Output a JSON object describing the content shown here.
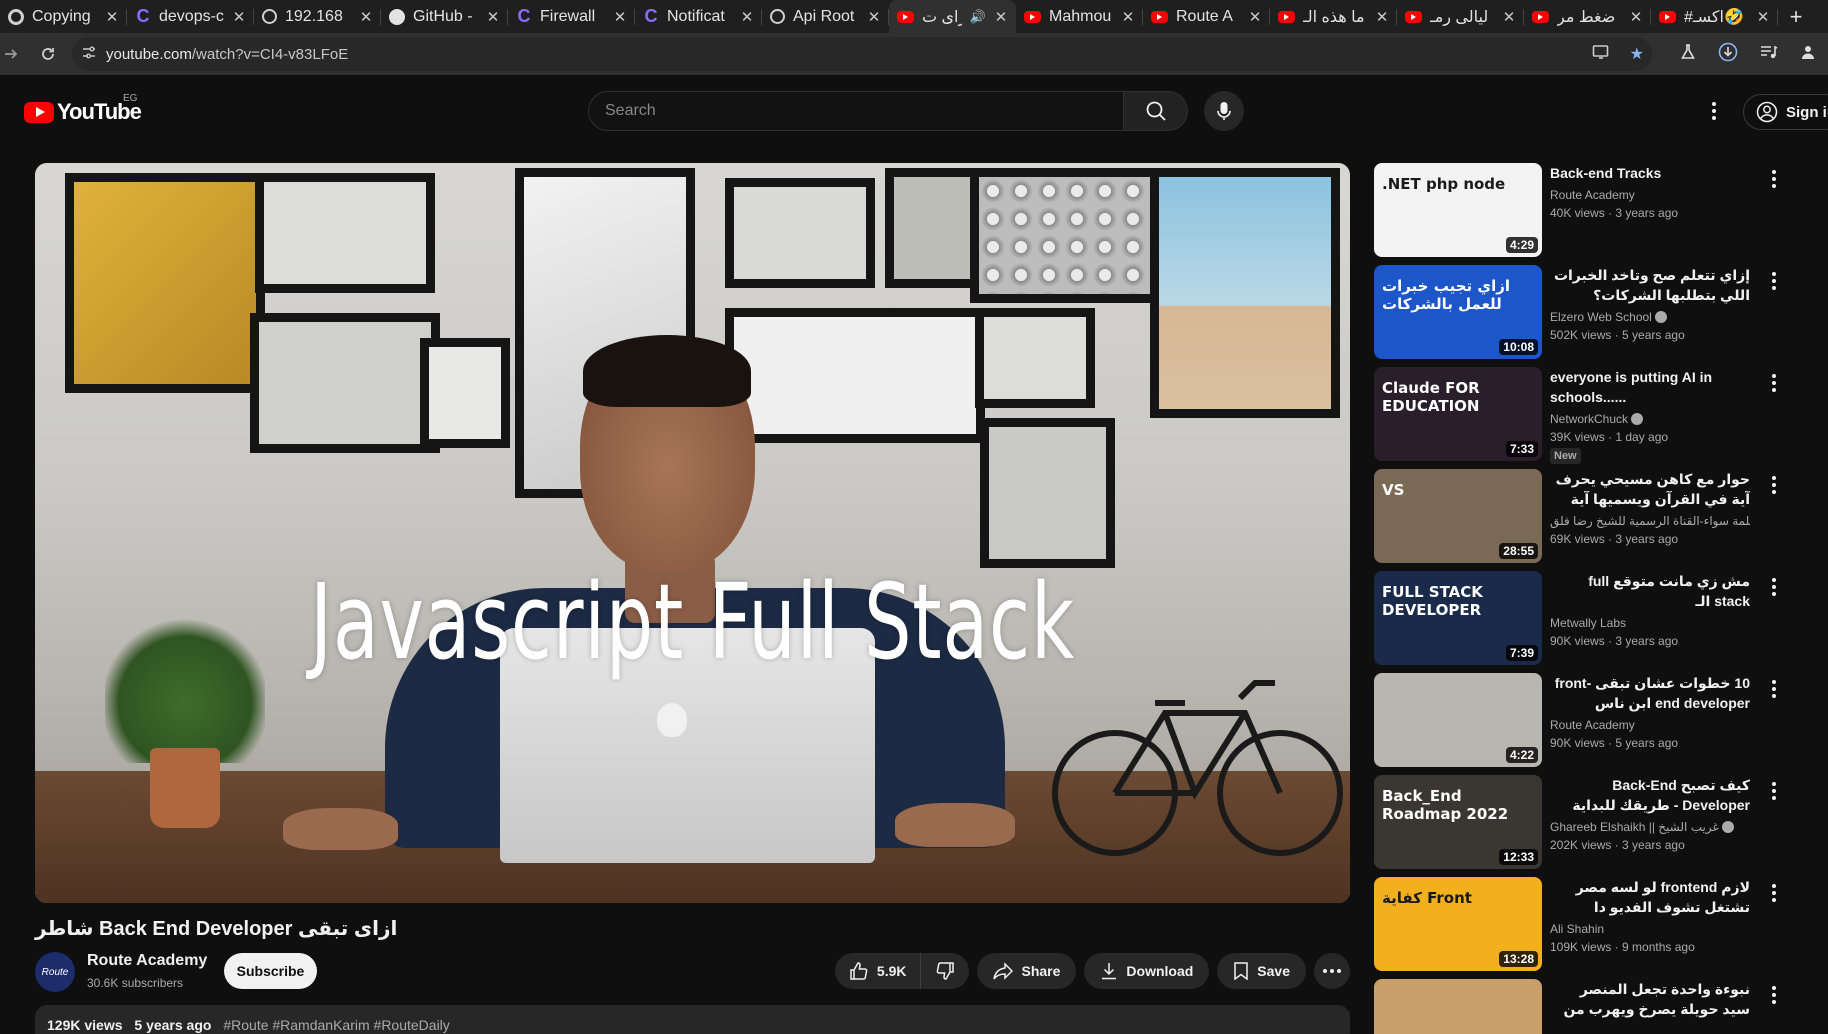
{
  "browser": {
    "tabs": [
      {
        "title": "Copying",
        "icon": "chrome-icon"
      },
      {
        "title": "devops-c",
        "icon": "c-icon"
      },
      {
        "title": "192.168",
        "icon": "globe-icon"
      },
      {
        "title": "GitHub -",
        "icon": "github-icon"
      },
      {
        "title": "Firewall",
        "icon": "c-icon"
      },
      {
        "title": "Notificat",
        "icon": "c-icon"
      },
      {
        "title": "Api Root",
        "icon": "globe-icon"
      },
      {
        "title": "ازاى ت",
        "icon": "youtube-icon",
        "active": true,
        "audio": true
      },
      {
        "title": "Mahmou",
        "icon": "youtube-icon"
      },
      {
        "title": "Route A",
        "icon": "youtube-icon"
      },
      {
        "title": "ما هذه الـ",
        "icon": "youtube-icon"
      },
      {
        "title": "ليالى رمـ",
        "icon": "youtube-icon"
      },
      {
        "title": "ضغط مر",
        "icon": "youtube-icon"
      },
      {
        "title": "#اكسـ🤣",
        "icon": "youtube-icon"
      }
    ],
    "url_host": "youtube.com",
    "url_path": "/watch?v=CI4-v83LFoE"
  },
  "masthead": {
    "logo_text": "YouTube",
    "country_code": "EG",
    "search_placeholder": "Search",
    "signin_label": "Sign in"
  },
  "video": {
    "overlay_text": "Javascript Full Stack",
    "title": "ازاى تبقى Back End Developer شاطر",
    "channel": "Route Academy",
    "channel_avatar_text": "Route",
    "subscribers": "30.6K subscribers",
    "subscribe_label": "Subscribe",
    "likes": "5.9K",
    "share_label": "Share",
    "download_label": "Download",
    "save_label": "Save",
    "views": "129K views",
    "age": "5 years ago",
    "hashtags": "#Route #RamdanKarim #RouteDaily"
  },
  "recommendations": [
    {
      "title": "Back-end Tracks",
      "channel": "Route Academy",
      "meta": "40K views · 3 years ago",
      "duration": "4:29",
      "rtl": false,
      "thumb_text": ".NET php node",
      "thumb_color": "#f3f3f3"
    },
    {
      "title": "إزاي تتعلم صح وتاخد الخبرات اللي بتطلبها الشركات؟",
      "channel": "Elzero Web School",
      "verified": true,
      "meta": "502K views · 5 years ago",
      "duration": "10:08",
      "rtl": true,
      "thumb_text": "ازاي تجيب خبرات للعمل بالشركات",
      "thumb_color": "#1d56c9"
    },
    {
      "title": "everyone is putting AI in schools......",
      "channel": "NetworkChuck",
      "verified": true,
      "meta": "39K views · 1 day ago",
      "badge": "New",
      "duration": "7:33",
      "rtl": false,
      "thumb_text": "Claude FOR EDUCATION",
      "thumb_color": "#2a1e2b"
    },
    {
      "title": "حوار مع كاهن مسيحي يحرف آية في القرآن ويسميها آية النفخ 😂 ويطالب",
      "channel": "كلمة سواء-القناة الرسمية للشيخ رضا فلق...",
      "meta": "69K views · 3 years ago",
      "duration": "28:55",
      "rtl": true,
      "thumb_text": "VS",
      "thumb_color": "#7a6a55"
    },
    {
      "title": "مش زي مانت متوقع full stack الـ",
      "channel": "Metwally Labs",
      "meta": "90K views · 3 years ago",
      "duration": "7:39",
      "rtl": true,
      "thumb_text": "FULL STACK DEVELOPER",
      "thumb_color": "#1a2a4a"
    },
    {
      "title": "10 خطوات عشان تبقى front-end developer ابن ناس",
      "channel": "Route Academy",
      "meta": "90K views · 5 years ago",
      "duration": "4:22",
      "rtl": true,
      "thumb_text": "",
      "thumb_color": "#b8b6b0"
    },
    {
      "title": "كيف تصبح Back-End Developer - طريقك للبداية في تطوير الويب.",
      "channel": "Ghareeb Elshaikh || غريب الشيخ",
      "verified": true,
      "meta": "202K views · 3 years ago",
      "duration": "12:33",
      "rtl": true,
      "thumb_text": "Back_End Roadmap 2022",
      "thumb_color": "#3a3632"
    },
    {
      "title": "لازم frontend لو لسه مصر تشتغل تشوف الفديو دا",
      "channel": "Ali Shahin",
      "meta": "109K views · 9 months ago",
      "duration": "13:28",
      "rtl": true,
      "thumb_text": "كفاية Front",
      "thumb_color": "#f2b01e"
    },
    {
      "title": "نبوءة واحدة تجعل المنصر سيد حويلة يصرخ ويهرب من قبضة الشيخ رضا",
      "channel": "",
      "meta": "",
      "duration": "",
      "rtl": true,
      "thumb_text": "",
      "thumb_color": "#c9a06a"
    }
  ]
}
